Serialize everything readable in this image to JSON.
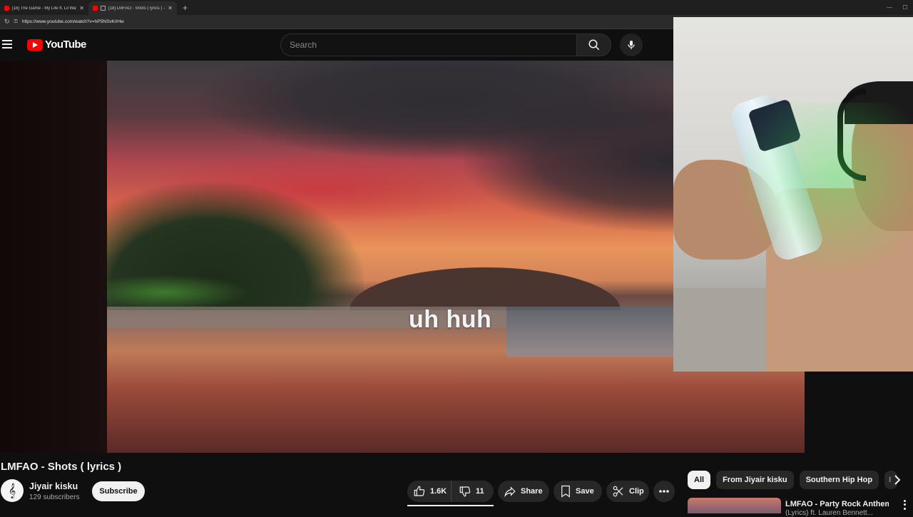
{
  "browser": {
    "tabs": [
      {
        "title": "[18] The Game - My Life ft. Lil Way...",
        "active": false
      },
      {
        "title": "[18] LMFAO - Shots ( lyrics ) -",
        "active": true
      }
    ],
    "new_tab": "+",
    "url": "https://www.youtube.com/watch?v=hP5NSvKriHw"
  },
  "header": {
    "logo_text": "YouTube",
    "search_placeholder": "Search"
  },
  "video": {
    "lyric_caption": "uh huh"
  },
  "details": {
    "title": "LMFAO - Shots ( lyrics )",
    "channel_name": "Jiyair kisku",
    "subscriber_count": "129 subscribers",
    "subscribe_label": "Subscribe",
    "like_count": "1.6K",
    "dislike_count": "11",
    "share_label": "Share",
    "save_label": "Save",
    "clip_label": "Clip"
  },
  "chips": [
    "All",
    "From Jiyair kisku",
    "Southern Hip Hop",
    "I"
  ],
  "recommendation": {
    "title": "LMFAO - Party Rock Anthem",
    "subtitle": "(Lyrics) ft. Lauren Bennett..."
  },
  "colors": {
    "background": "#0f0f0f",
    "brand_red": "#ff0000",
    "pill_bg": "#272727",
    "text": "#f1f1f1"
  }
}
